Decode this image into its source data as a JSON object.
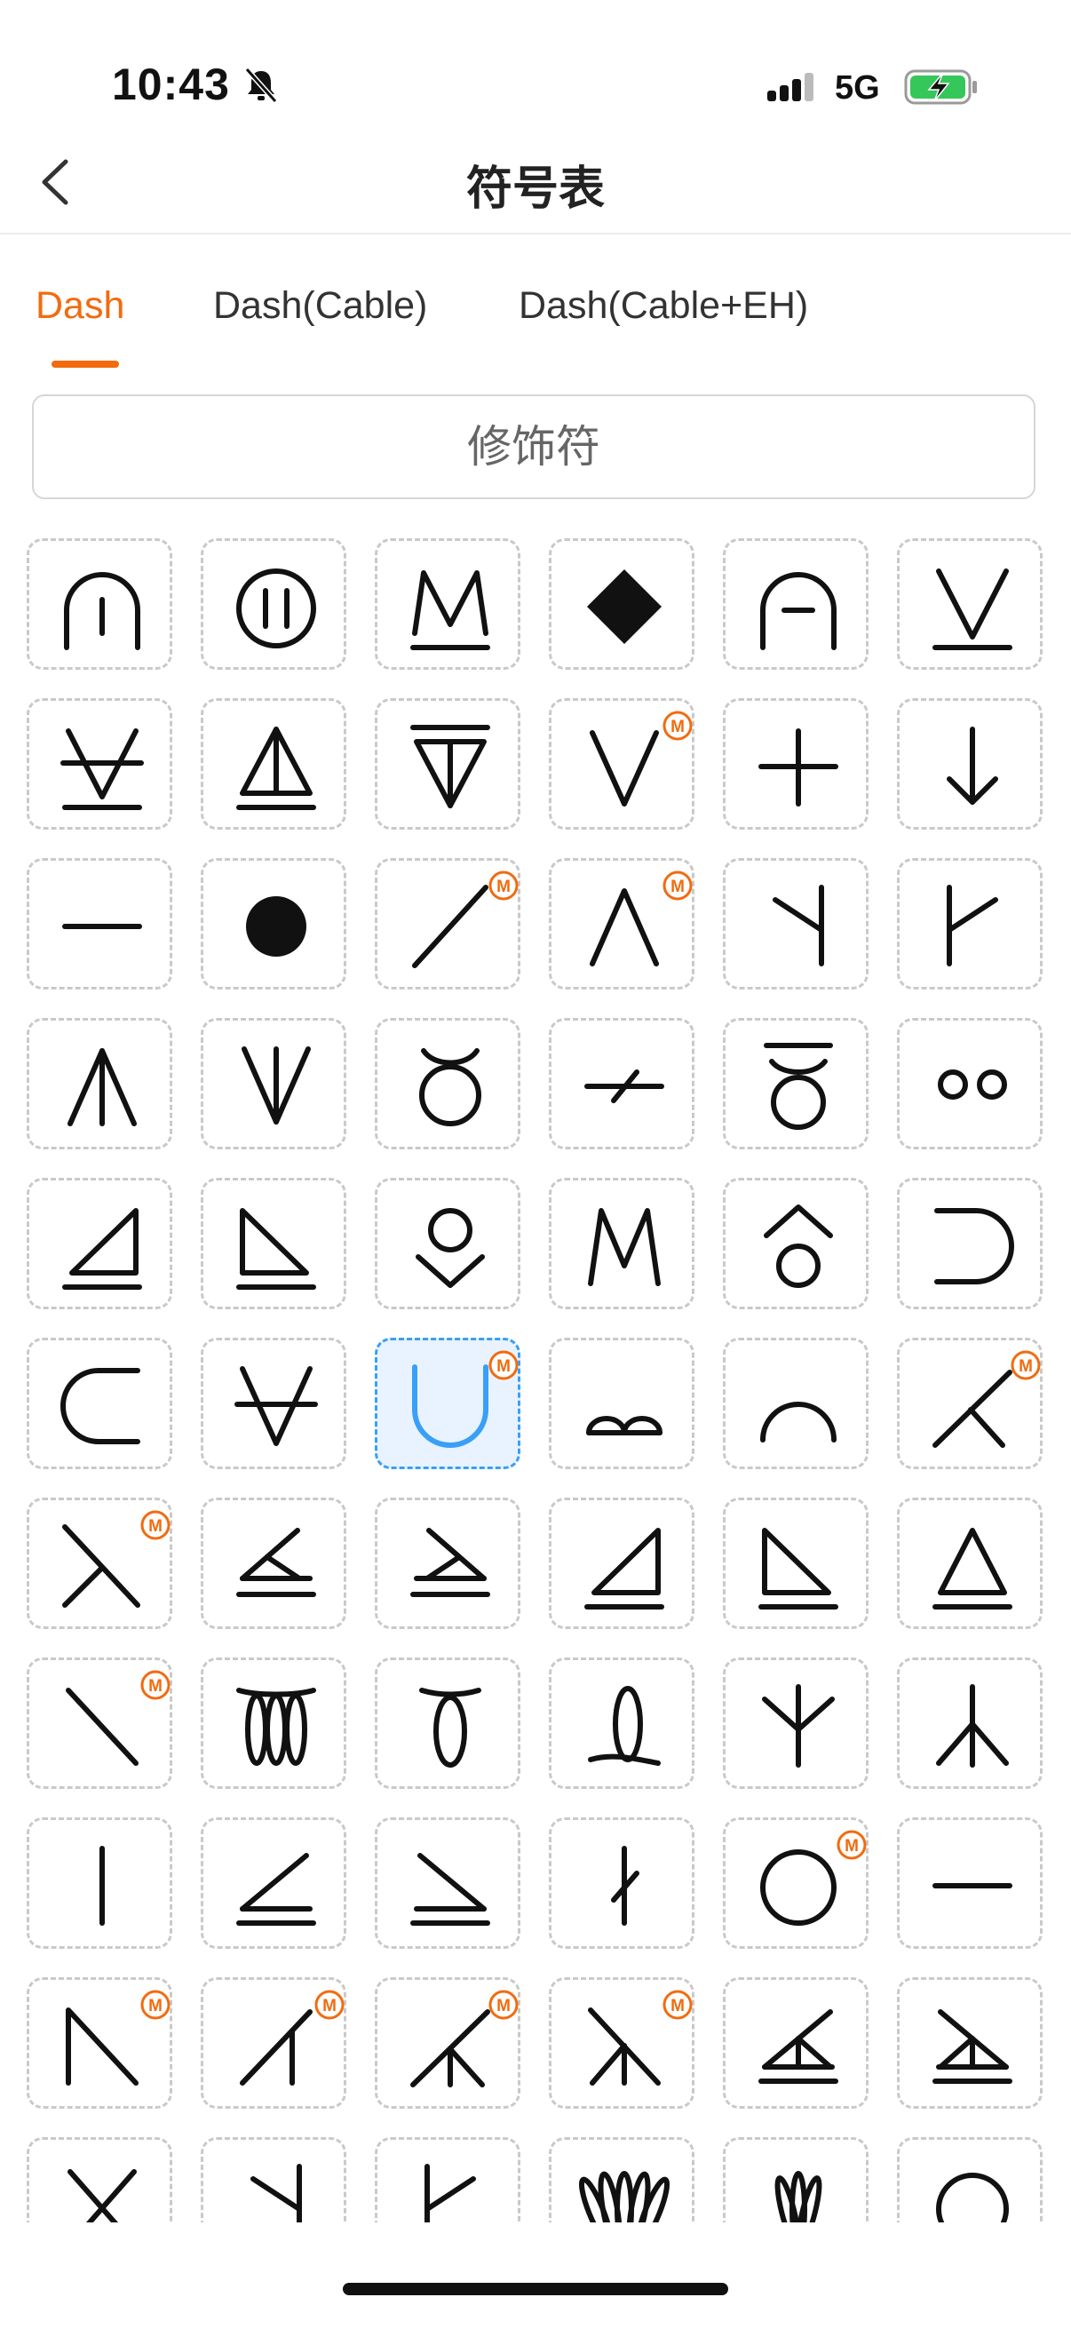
{
  "status": {
    "time": "10:43",
    "network": "5G"
  },
  "nav": {
    "title": "符号表"
  },
  "tabs": [
    {
      "label": "Dash",
      "active": true
    },
    {
      "label": "Dash(Cable)",
      "active": false
    },
    {
      "label": "Dash(Cable+EH)",
      "active": false
    }
  ],
  "modifier_button": {
    "label": "修饰符"
  },
  "colors": {
    "accent": "#f26b0f",
    "selected_border": "#3a9ff7",
    "selected_fill": "#e8f3ff",
    "cell_border": "#c9c9c9"
  },
  "symbols": [
    {
      "icon": "arch-vertical-line"
    },
    {
      "icon": "circle-double-line"
    },
    {
      "icon": "m-underlined"
    },
    {
      "icon": "filled-diamond"
    },
    {
      "icon": "arch-horizontal-line"
    },
    {
      "icon": "v-underlined"
    },
    {
      "icon": "v-crossed-underlined"
    },
    {
      "icon": "triangle-split-underlined"
    },
    {
      "icon": "triangle-inverted-split-overlined"
    },
    {
      "icon": "v-shape",
      "badge": "M"
    },
    {
      "icon": "plus"
    },
    {
      "icon": "down-arrow"
    },
    {
      "icon": "horizontal-dash"
    },
    {
      "icon": "filled-dot"
    },
    {
      "icon": "diagonal-slash",
      "badge": "M"
    },
    {
      "icon": "caret-up",
      "badge": "M"
    },
    {
      "icon": "y-reverse"
    },
    {
      "icon": "k-branch"
    },
    {
      "icon": "caret-up-split"
    },
    {
      "icon": "v-split"
    },
    {
      "icon": "loop-down"
    },
    {
      "icon": "dash-tick"
    },
    {
      "icon": "loop-overlined"
    },
    {
      "icon": "double-circle-small"
    },
    {
      "icon": "right-triangle-left"
    },
    {
      "icon": "right-triangle-right"
    },
    {
      "icon": "circle-over-chevron"
    },
    {
      "icon": "m-letter"
    },
    {
      "icon": "circle-under-caret"
    },
    {
      "icon": "open-right-curve"
    },
    {
      "icon": "open-left-curve"
    },
    {
      "icon": "v-crossed"
    },
    {
      "icon": "u-shape",
      "badge": "M",
      "selected": true
    },
    {
      "icon": "bow-arcs"
    },
    {
      "icon": "half-arc"
    },
    {
      "icon": "angle-branch",
      "badge": "M"
    },
    {
      "icon": "x-lambda",
      "badge": "M"
    },
    {
      "icon": "angle-left-underlined"
    },
    {
      "icon": "angle-right-underlined"
    },
    {
      "icon": "right-triangle-left-underlined"
    },
    {
      "icon": "right-triangle-right-underlined"
    },
    {
      "icon": "triangle-underlined"
    },
    {
      "icon": "backslash",
      "badge": "M"
    },
    {
      "icon": "triple-loops"
    },
    {
      "icon": "single-loop-bar"
    },
    {
      "icon": "loop-ell"
    },
    {
      "icon": "y-branch"
    },
    {
      "icon": "inverted-y-branch"
    },
    {
      "icon": "vertical-bar"
    },
    {
      "icon": "less-than-underlined"
    },
    {
      "icon": "greater-than-underlined"
    },
    {
      "icon": "bar-tick"
    },
    {
      "icon": "hollow-circle",
      "badge": "M"
    },
    {
      "icon": "long-dash"
    },
    {
      "icon": "n-angle",
      "badge": "M"
    },
    {
      "icon": "slash-angle",
      "badge": "M"
    },
    {
      "icon": "angle-split-branch",
      "badge": "M"
    },
    {
      "icon": "lambda-split",
      "badge": "M"
    },
    {
      "icon": "angle-split-underlined"
    },
    {
      "icon": "angle-split-underlined-right"
    },
    {
      "icon": "x-cross"
    },
    {
      "icon": "y-reverse-2"
    },
    {
      "icon": "k-branch-2"
    },
    {
      "icon": "fan-wide"
    },
    {
      "icon": "fan-narrow"
    },
    {
      "icon": "circle-outline"
    }
  ]
}
